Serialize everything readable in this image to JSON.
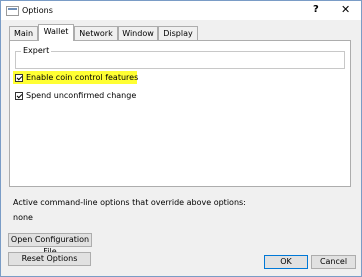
{
  "window": {
    "title": "Options",
    "help_glyph": "?",
    "close_glyph": "✕"
  },
  "tabs": [
    {
      "label": "Main"
    },
    {
      "label": "Wallet"
    },
    {
      "label": "Network"
    },
    {
      "label": "Window"
    },
    {
      "label": "Display"
    }
  ],
  "active_tab": "Wallet",
  "wallet": {
    "group_title": "Expert",
    "options": [
      {
        "label": "Enable coin control features",
        "checked": true,
        "highlighted": true,
        "highlight_color": "#ffff33"
      },
      {
        "label": "Spend unconfirmed change",
        "checked": true
      }
    ]
  },
  "footer": {
    "override_label": "Active command-line options that override above options:",
    "override_value": "none"
  },
  "buttons": {
    "open_config": "Open Configuration File",
    "reset": "Reset Options",
    "ok": "OK",
    "cancel": "Cancel"
  },
  "colors": {
    "window_border": "#7a9cc6",
    "default_button_border": "#0078d7"
  }
}
